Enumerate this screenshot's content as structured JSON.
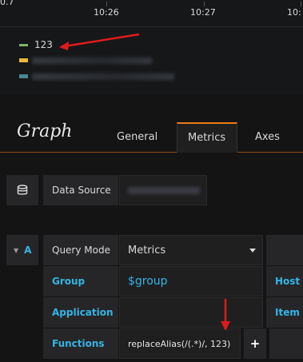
{
  "chart": {
    "y_tick_top": "0.7",
    "x_ticks": [
      "10:26",
      "10:27",
      "10:"
    ],
    "legend": [
      {
        "name": "123",
        "color": "#7eb26d"
      },
      {
        "name": "",
        "color": "#eab839"
      },
      {
        "name": "",
        "color": "#6ed0e0"
      }
    ]
  },
  "editor": {
    "title": "Graph",
    "tabs": [
      {
        "label": "General",
        "active": false
      },
      {
        "label": "Metrics",
        "active": true
      },
      {
        "label": "Axes",
        "active": false
      }
    ],
    "datasource": {
      "icon": "database-icon",
      "label": "Data Source",
      "value": ""
    },
    "query": {
      "ref_id": "A",
      "query_mode_label": "Query Mode",
      "query_mode_value": "Metrics",
      "group_label": "Group",
      "group_value": "$group",
      "host_label": "Host",
      "application_label": "Application",
      "application_value": "",
      "item_label": "Item",
      "functions_label": "Functions",
      "function_value": "replaceAlias(/(.*)/, 123)",
      "add_function_label": "+"
    },
    "colors": {
      "accent": "#eb7b18",
      "label_blue": "#33b5e5",
      "annotation_red": "#e01a1a"
    }
  }
}
